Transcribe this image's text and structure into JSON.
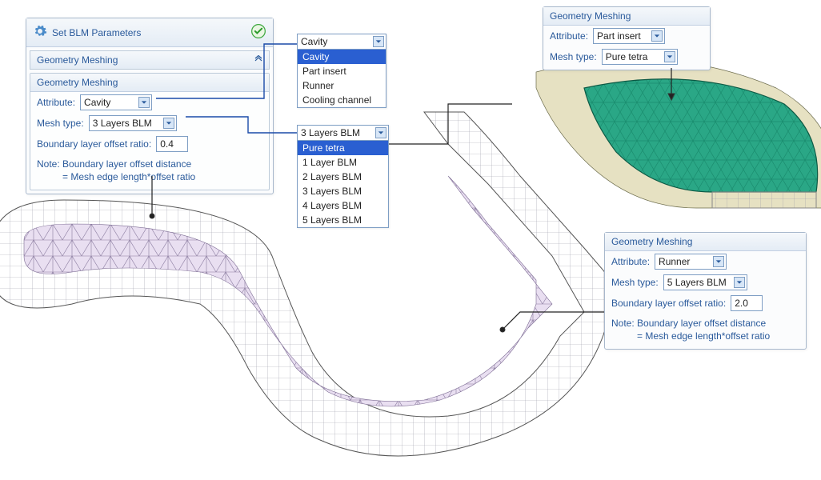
{
  "main_panel": {
    "title": "Set BLM Parameters",
    "section_header": "Geometry Meshing",
    "subpanel_title": "Geometry Meshing",
    "attribute_label": "Attribute:",
    "attribute_value": "Cavity",
    "meshtype_label": "Mesh type:",
    "meshtype_value": "3 Layers BLM",
    "offset_label": "Boundary layer offset ratio:",
    "offset_value": "0.4",
    "note_line1": "Note: Boundary layer offset distance",
    "note_line2": "= Mesh edge length*offset ratio"
  },
  "attr_dropdown": {
    "selected": "Cavity",
    "options": [
      "Cavity",
      "Part insert",
      "Runner",
      "Cooling channel"
    ]
  },
  "meshtype_dropdown": {
    "selected": "3 Layers BLM",
    "options": [
      "Pure tetra",
      "1 Layer BLM",
      "2 Layers BLM",
      "3 Layers BLM",
      "4 Layers BLM",
      "5 Layers BLM"
    ]
  },
  "panel_partinsert": {
    "title": "Geometry Meshing",
    "attribute_label": "Attribute:",
    "attribute_value": "Part insert",
    "meshtype_label": "Mesh type:",
    "meshtype_value": "Pure tetra"
  },
  "panel_runner": {
    "title": "Geometry Meshing",
    "attribute_label": "Attribute:",
    "attribute_value": "Runner",
    "meshtype_label": "Mesh type:",
    "meshtype_value": "5 Layers BLM",
    "offset_label": "Boundary layer offset ratio:",
    "offset_value": "2.0",
    "note_line1": "Note: Boundary layer offset distance",
    "note_line2": "= Mesh edge length*offset ratio"
  }
}
